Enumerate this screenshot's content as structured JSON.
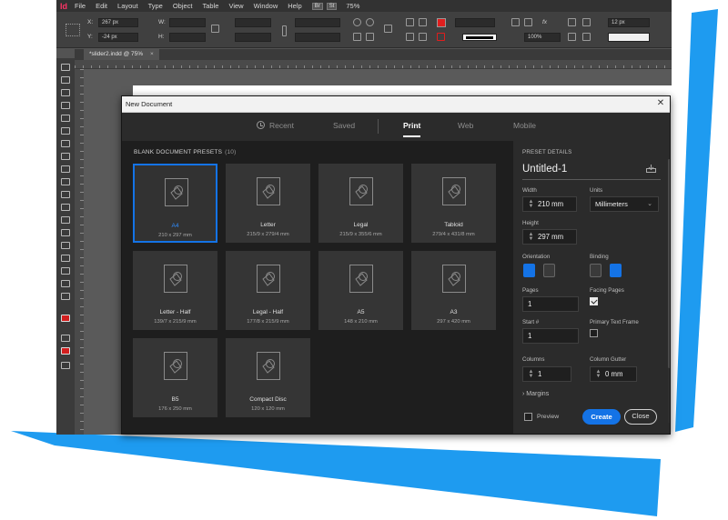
{
  "menubar": {
    "logo": "Id",
    "items": [
      "File",
      "Edit",
      "Layout",
      "Type",
      "Object",
      "Table",
      "View",
      "Window",
      "Help"
    ],
    "badges": [
      "Br",
      "St"
    ],
    "zoom": "75%"
  },
  "control": {
    "x_label": "X:",
    "x_value": "267 px",
    "y_label": "Y:",
    "y_value": "-24 px",
    "w_label": "W:",
    "h_label": "H:",
    "font_size": "12 px",
    "opacity": "100%"
  },
  "doc_tab": {
    "title": "*slider2.indd @ 75%",
    "close": "×"
  },
  "colors": {
    "accent": "#1473e6",
    "swoosh": "#1e9bf0",
    "swatch": "#e01e1e"
  },
  "dialog": {
    "title": "New Document",
    "close_glyph": "✕",
    "tabs": [
      {
        "label": "Recent",
        "icon": "clock-icon"
      },
      {
        "label": "Saved"
      },
      {
        "label": "Print",
        "active": true
      },
      {
        "label": "Web"
      },
      {
        "label": "Mobile"
      }
    ],
    "presets_label": "BLANK DOCUMENT PRESETS",
    "presets_count": "(10)",
    "presets": [
      {
        "name": "A4",
        "dims": "210 x 297 mm",
        "selected": true
      },
      {
        "name": "Letter",
        "dims": "215/9 x 279/4 mm"
      },
      {
        "name": "Legal",
        "dims": "215/9 x 355/6 mm"
      },
      {
        "name": "Tabloid",
        "dims": "279/4 x 431/8 mm"
      },
      {
        "name": "Letter - Half",
        "dims": "139/7 x 215/9 mm"
      },
      {
        "name": "Legal - Half",
        "dims": "177/8 x 215/9 mm"
      },
      {
        "name": "A5",
        "dims": "148 x 210 mm"
      },
      {
        "name": "A3",
        "dims": "297 x 420 mm"
      },
      {
        "name": "B5",
        "dims": "176 x 250 mm"
      },
      {
        "name": "Compact Disc",
        "dims": "120 x 120 mm"
      }
    ],
    "details": {
      "section_label": "PRESET DETAILS",
      "name": "Untitled-1",
      "width_label": "Width",
      "width_value": "210 mm",
      "units_label": "Units",
      "units_value": "Millimeters",
      "height_label": "Height",
      "height_value": "297 mm",
      "orientation_label": "Orientation",
      "binding_label": "Binding",
      "pages_label": "Pages",
      "pages_value": "1",
      "facing_label": "Facing Pages",
      "start_label": "Start #",
      "start_value": "1",
      "ptf_label": "Primary Text Frame",
      "columns_label": "Columns",
      "columns_value": "1",
      "gutter_label": "Column Gutter",
      "gutter_value": "0 mm",
      "margins_label": "Margins",
      "preview_label": "Preview",
      "create_label": "Create",
      "close_label": "Close"
    }
  }
}
